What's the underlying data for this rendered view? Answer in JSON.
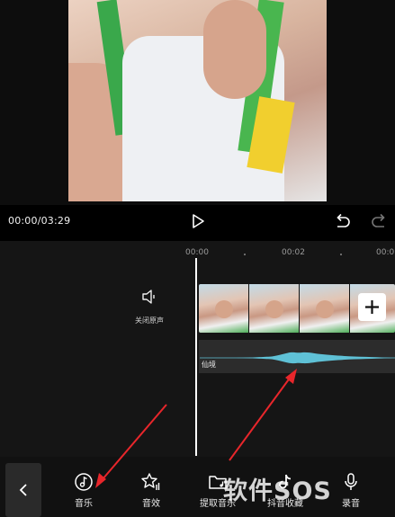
{
  "player": {
    "timecode": "00:00/03:29"
  },
  "timeline": {
    "ruler": [
      "00:00",
      "00:02",
      "00:0"
    ],
    "mute_label": "关闭原声",
    "audio_track_label": "仙境"
  },
  "toolbar": {
    "items": [
      {
        "label": "音乐",
        "icon": "music-note-icon"
      },
      {
        "label": "音效",
        "icon": "sound-effect-icon"
      },
      {
        "label": "提取音乐",
        "icon": "folder-music-icon"
      },
      {
        "label": "抖音收藏",
        "icon": "tiktok-icon"
      },
      {
        "label": "录音",
        "icon": "microphone-icon"
      }
    ]
  },
  "watermark": "软件SOS",
  "colors": {
    "waveform": "#5fc1d6",
    "annotation_arrow": "#e8262b",
    "background": "#000000"
  }
}
